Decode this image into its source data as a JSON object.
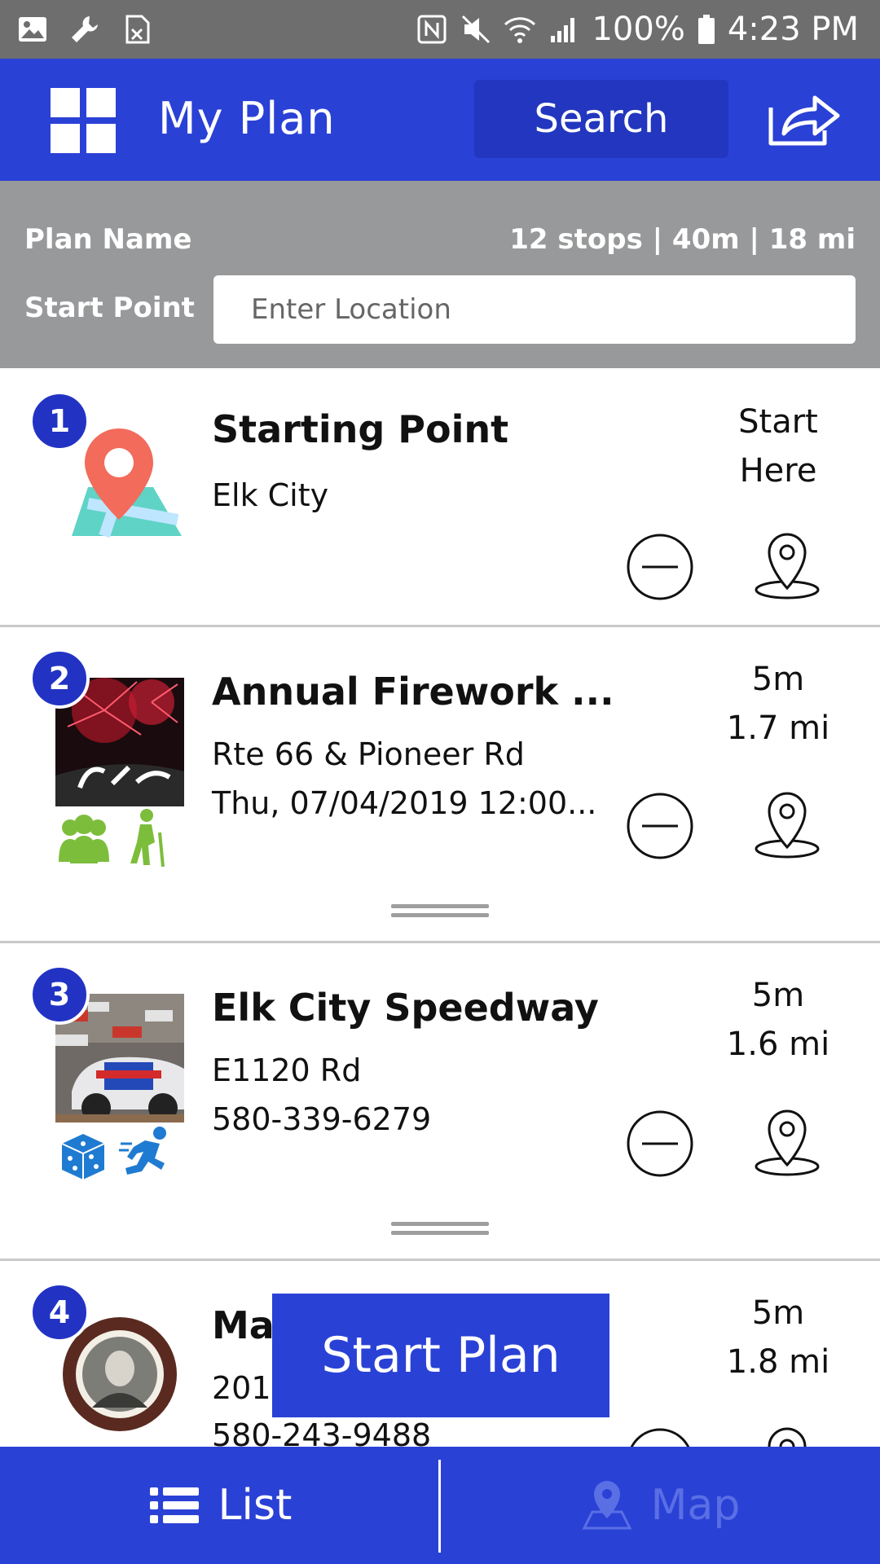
{
  "status_bar": {
    "battery": "100%",
    "time": "4:23 PM",
    "left_icons": [
      "image-icon",
      "wrench-icon",
      "sim-icon"
    ],
    "right_icons": [
      "nfc-icon",
      "mute-icon",
      "wifi-icon",
      "signal-icon",
      "battery-icon"
    ]
  },
  "header": {
    "title": "My Plan",
    "search_label": "Search",
    "menu_icon": "grid-icon",
    "share_icon": "share-icon"
  },
  "plan": {
    "name_label": "Plan Name",
    "stats": "12 stops | 40m | 18 mi",
    "start_label": "Start Point",
    "start_placeholder": "Enter Location"
  },
  "stops": [
    {
      "number": "1",
      "title": "Starting Point",
      "line1": "Elk City",
      "line2": "",
      "metric1": "Start",
      "metric2": "Here",
      "thumb": "map-pin-illustration",
      "tags": []
    },
    {
      "number": "2",
      "title": "Annual Firework ...",
      "line1": "Rte 66 & Pioneer Rd",
      "line2": "Thu, 07/04/2019 12:00...",
      "metric1": "5m",
      "metric2": "1.7 mi",
      "thumb": "fireworks-photo",
      "tags": [
        "group-icon",
        "hiker-icon"
      ]
    },
    {
      "number": "3",
      "title": "Elk City Speedway",
      "line1": "E1120 Rd",
      "line2": "580-339-6279",
      "metric1": "5m",
      "metric2": "1.6 mi",
      "thumb": "race-cars-photo",
      "tags": [
        "dice-icon",
        "runner-icon"
      ]
    },
    {
      "number": "4",
      "title": "Ma",
      "line1": "201",
      "line2": "580-243-9488",
      "metric1": "5m",
      "metric2": "1.8 mi",
      "thumb": "portrait-seal",
      "tags": []
    }
  ],
  "start_plan_label": "Start Plan",
  "bottom_nav": {
    "list_label": "List",
    "map_label": "Map"
  },
  "colors": {
    "primary": "#2a41d6",
    "primary_dark": "#2236bf",
    "badge": "#2233c4",
    "header_gray": "#98999b",
    "status_gray": "#6e6e6e",
    "tag_green": "#7dbd3c",
    "tag_blue": "#1f7bd1"
  }
}
